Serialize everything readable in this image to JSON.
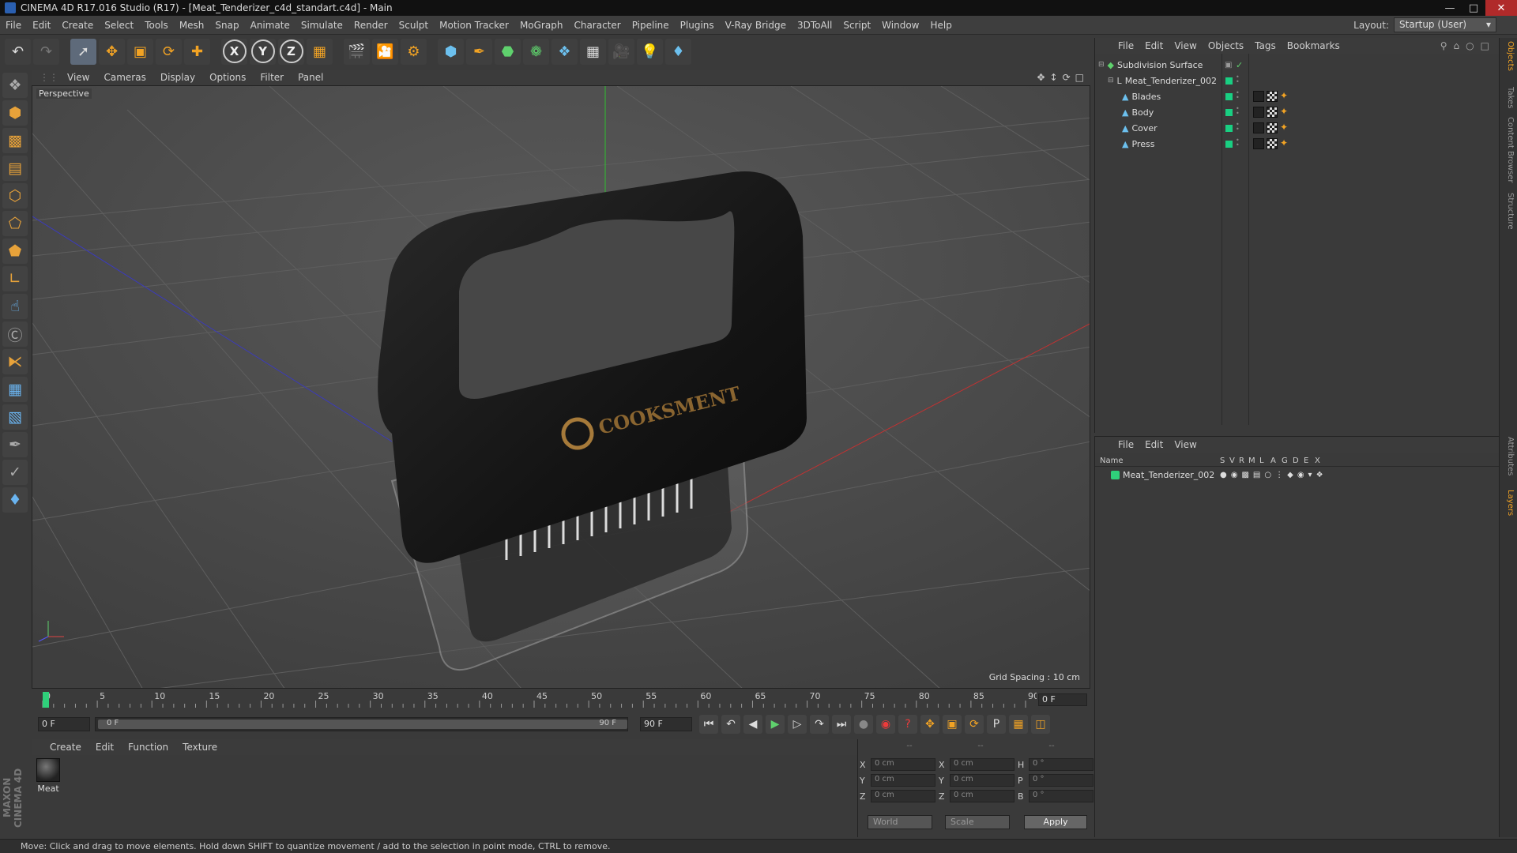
{
  "app": {
    "title": "CINEMA 4D R17.016 Studio (R17) - [Meat_Tenderizer_c4d_standart.c4d] - Main"
  },
  "menu": [
    "File",
    "Edit",
    "Create",
    "Select",
    "Tools",
    "Mesh",
    "Snap",
    "Animate",
    "Simulate",
    "Render",
    "Sculpt",
    "Motion Tracker",
    "MoGraph",
    "Character",
    "Pipeline",
    "Plugins",
    "V-Ray Bridge",
    "3DToAll",
    "Script",
    "Window",
    "Help"
  ],
  "layout": {
    "label": "Layout:",
    "value": "Startup (User)"
  },
  "viewport": {
    "menu": [
      "View",
      "Cameras",
      "Display",
      "Options",
      "Filter",
      "Panel"
    ],
    "label": "Perspective",
    "grid_spacing": "Grid Spacing : 10 cm",
    "logo_text": "COOKSMENT"
  },
  "timeline": {
    "ticks": [
      "0",
      "5",
      "10",
      "15",
      "20",
      "25",
      "30",
      "35",
      "40",
      "45",
      "50",
      "55",
      "60",
      "65",
      "70",
      "75",
      "80",
      "85",
      "90"
    ],
    "current": "0 F",
    "start": "0 F",
    "range_left": "0 F",
    "range_right": "90 F",
    "end": "90 F"
  },
  "material": {
    "menu": [
      "Create",
      "Edit",
      "Function",
      "Texture"
    ],
    "items": [
      {
        "name": "Meat"
      }
    ]
  },
  "maxon_logo": "MAXON CINEMA 4D",
  "coords": {
    "headers": [
      "--",
      "--",
      "--"
    ],
    "rows": [
      {
        "a1": "X",
        "v1": "0 cm",
        "a2": "X",
        "v2": "0 cm",
        "a3": "H",
        "v3": "0 °"
      },
      {
        "a1": "Y",
        "v1": "0 cm",
        "a2": "Y",
        "v2": "0 cm",
        "a3": "P",
        "v3": "0 °"
      },
      {
        "a1": "Z",
        "v1": "0 cm",
        "a2": "Z",
        "v2": "0 cm",
        "a3": "B",
        "v3": "0 °"
      }
    ],
    "space": "World",
    "mode": "Scale",
    "apply": "Apply"
  },
  "objects": {
    "menu": [
      "File",
      "Edit",
      "View",
      "Objects",
      "Tags",
      "Bookmarks"
    ],
    "tree": [
      {
        "name": "Subdivision Surface",
        "level": 0
      },
      {
        "name": "Meat_Tenderizer_002",
        "level": 1
      },
      {
        "name": "Blades",
        "level": 2
      },
      {
        "name": "Body",
        "level": 2
      },
      {
        "name": "Cover",
        "level": 2
      },
      {
        "name": "Press",
        "level": 2
      }
    ]
  },
  "layers": {
    "menu": [
      "File",
      "Edit",
      "View"
    ],
    "columns": [
      "Name",
      "S",
      "V",
      "R",
      "M",
      "L",
      "A",
      "G",
      "D",
      "E",
      "X"
    ],
    "rows": [
      {
        "name": "Meat_Tenderizer_002"
      }
    ]
  },
  "side_tabs": [
    "Objects",
    "Takes",
    "Content Browser",
    "Structure",
    "Attributes",
    "Layers"
  ],
  "status": "Move: Click and drag to move elements. Hold down SHIFT to quantize movement / add to the selection in point mode, CTRL to remove.",
  "colors": {
    "accent": "#f2a324",
    "layer_green": "#19cf82",
    "background": "#3a3a3a"
  }
}
